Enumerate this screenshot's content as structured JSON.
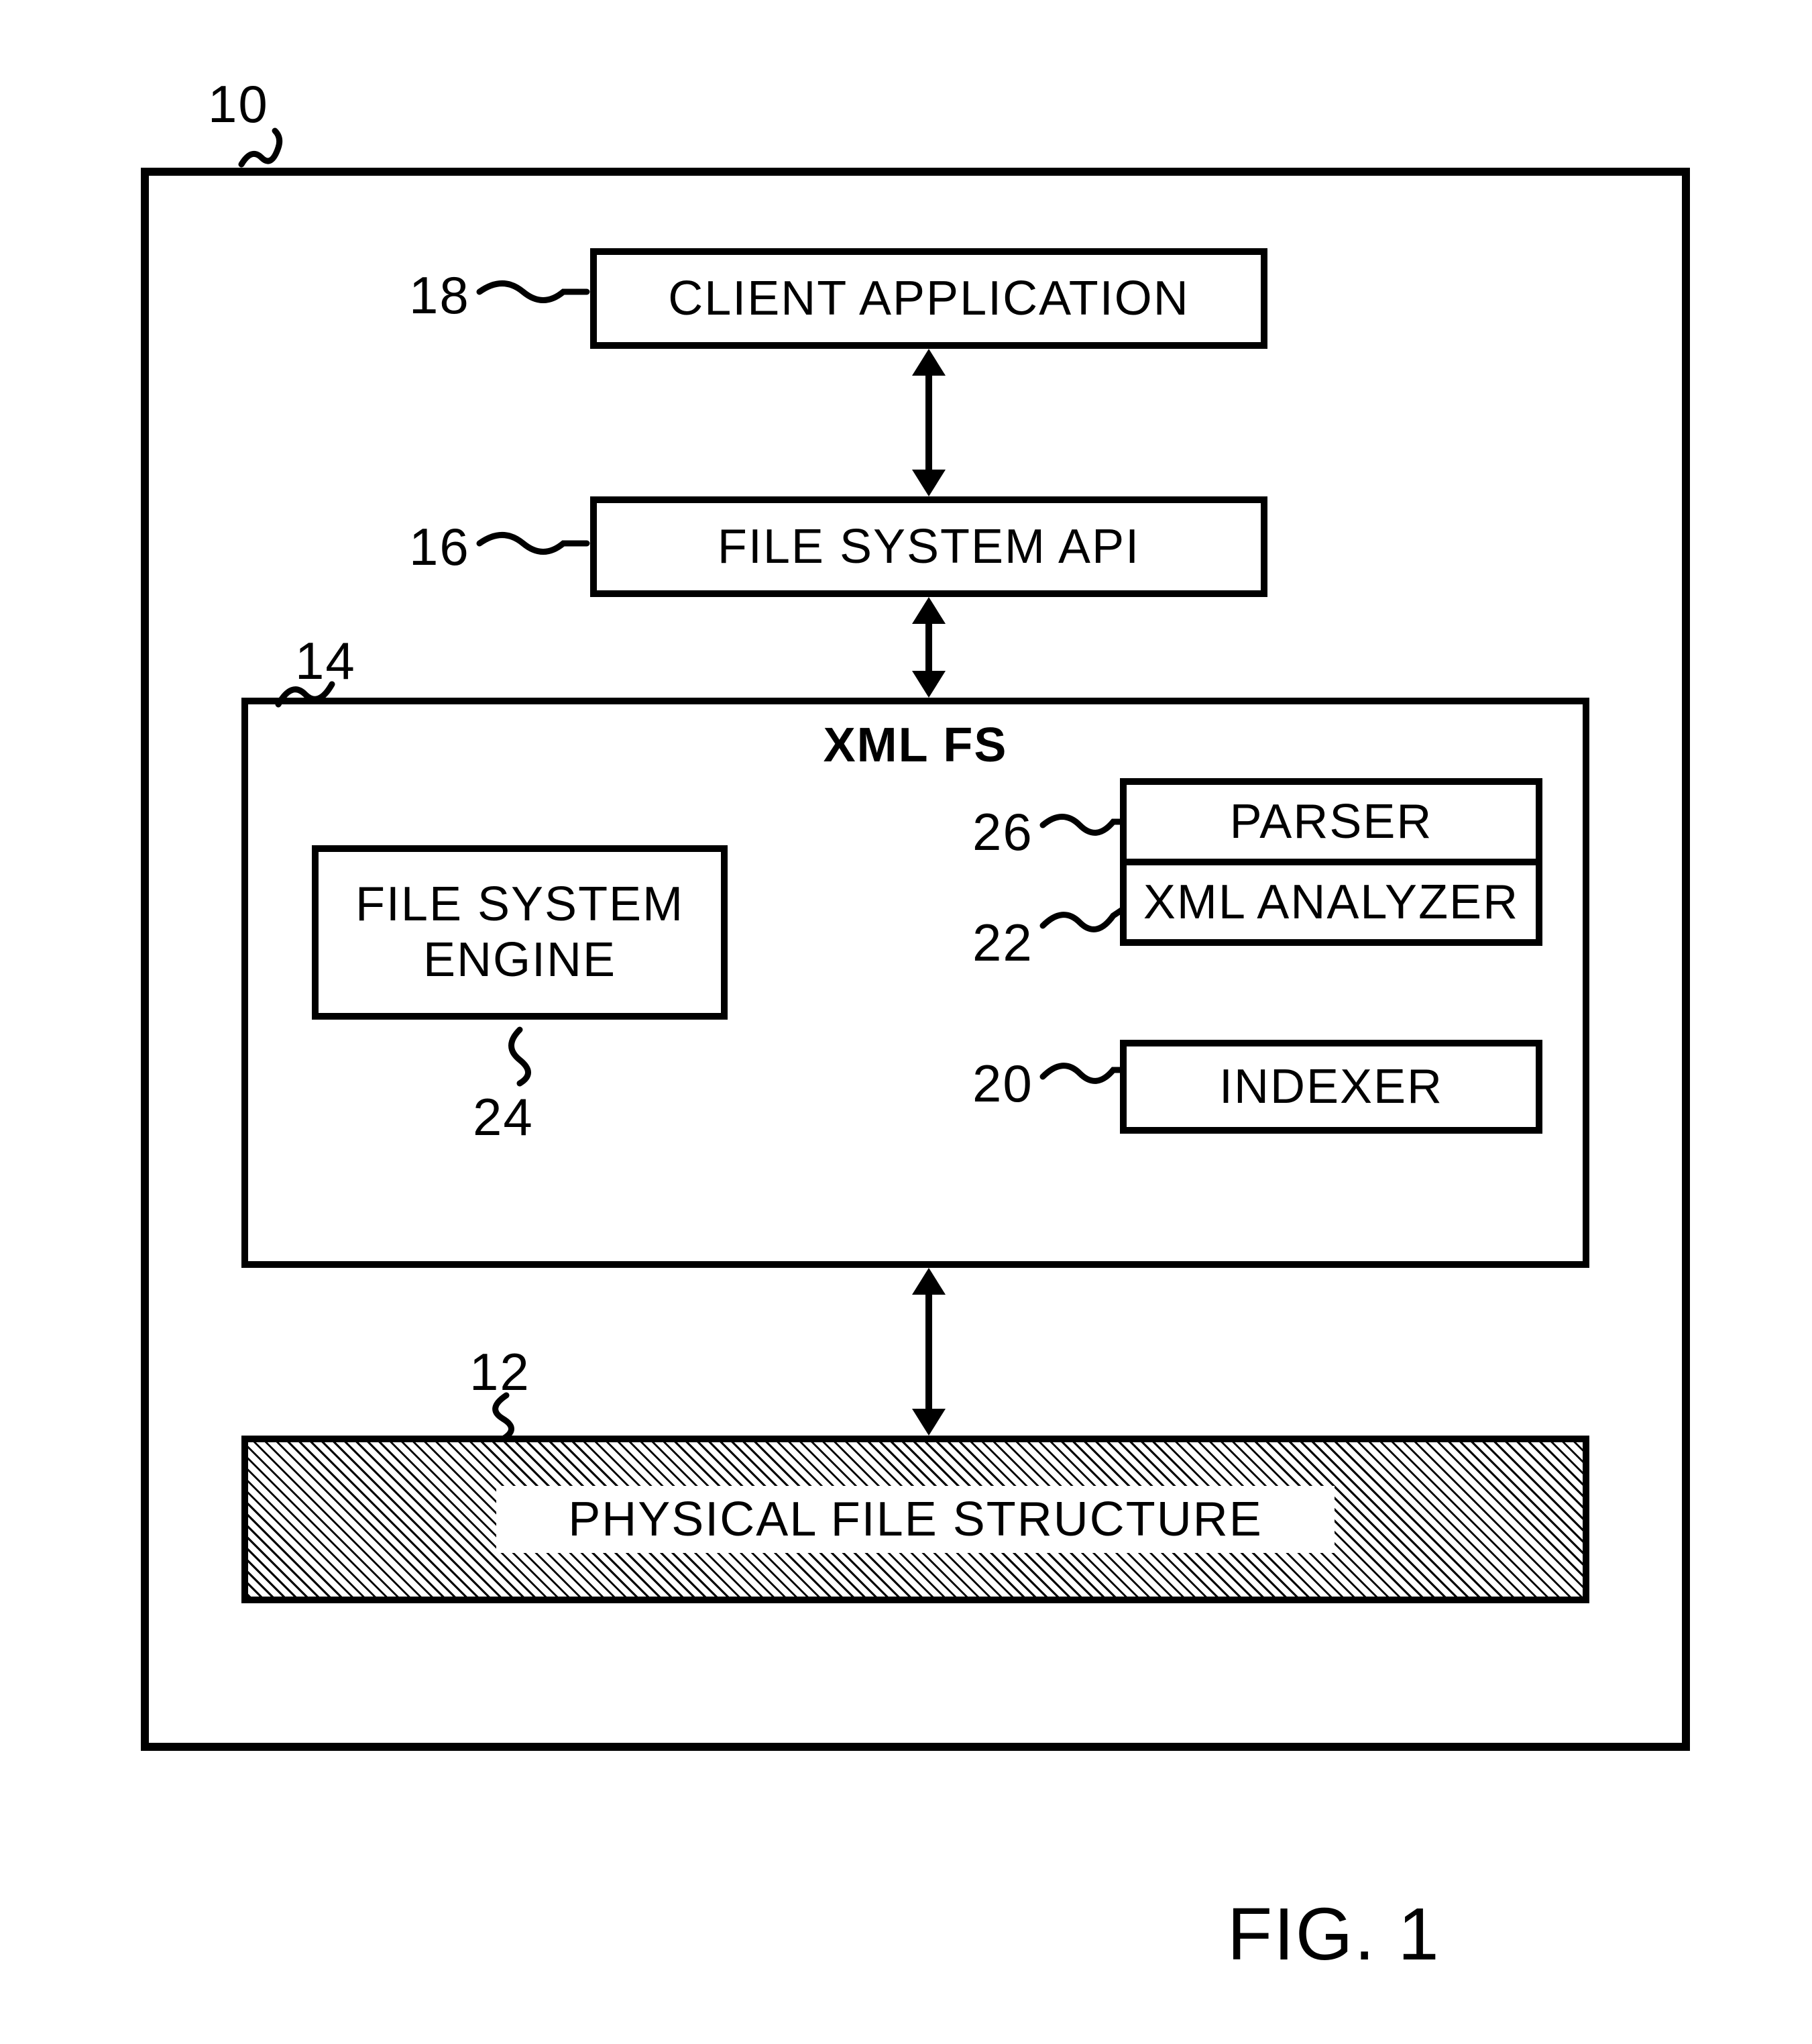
{
  "refs": {
    "outer": "10",
    "physical": "12",
    "xmlfs": "14",
    "api": "16",
    "client": "18",
    "indexer": "20",
    "analyzer": "22",
    "engine": "24",
    "parser": "26"
  },
  "boxes": {
    "client": "CLIENT APPLICATION",
    "api": "FILE SYSTEM API",
    "xmlfs_title": "XML FS",
    "engine": "FILE SYSTEM\nENGINE",
    "parser": "PARSER",
    "analyzer": "XML ANALYZER",
    "indexer": "INDEXER",
    "physical": "PHYSICAL FILE STRUCTURE"
  },
  "figure": "FIG. 1"
}
